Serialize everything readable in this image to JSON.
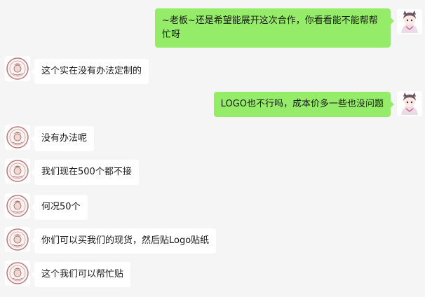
{
  "messages": [
    {
      "side": "out",
      "text": "~老板~还是希望能展开这次合作，你看看能不能帮帮忙呀"
    },
    {
      "side": "in",
      "text": "这个实在没有办法定制的"
    },
    {
      "side": "out",
      "text": "LOGO也不行吗，成本价多一些也没问题"
    },
    {
      "side": "in",
      "text": "没有办法呢"
    },
    {
      "side": "in",
      "text": "我们现在500个都不接"
    },
    {
      "side": "in",
      "text": "何况50个"
    },
    {
      "side": "in",
      "text": "你们可以买我们的现货，然后贴Logo贴纸"
    },
    {
      "side": "in",
      "text": "这个我们可以帮忙贴"
    }
  ],
  "colors": {
    "sent_bubble": "#95ec69",
    "received_bubble": "#ffffff",
    "background": "#f5f5f5"
  }
}
